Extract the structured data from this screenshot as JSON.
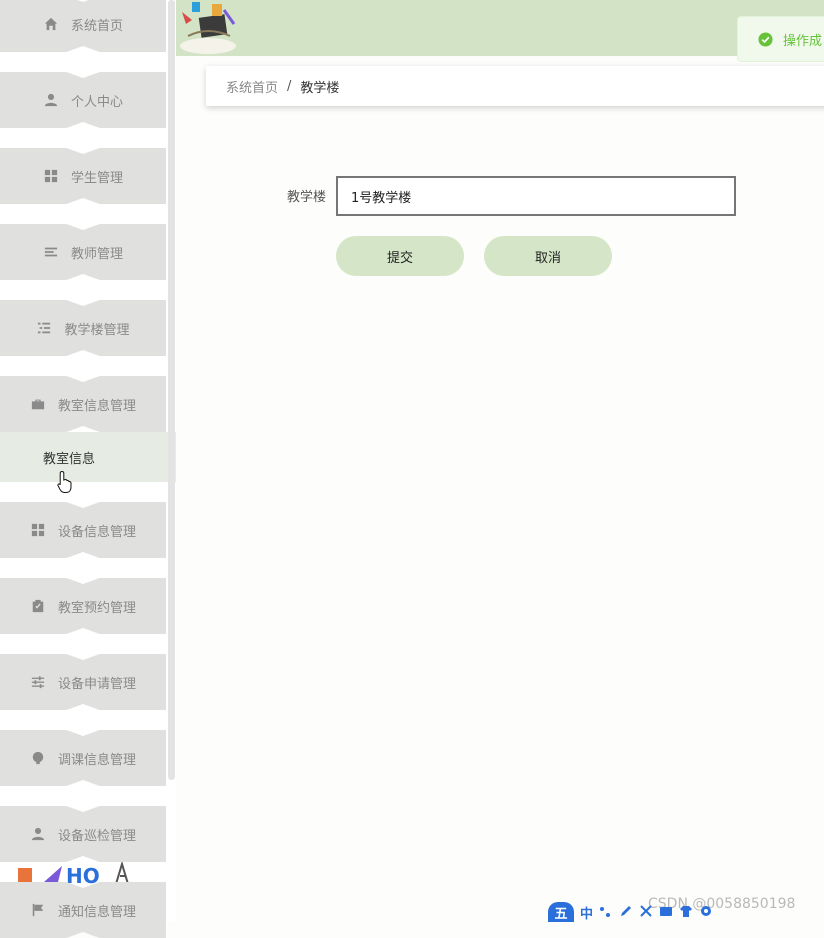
{
  "sidebar": {
    "items": [
      {
        "label": "系统首页",
        "icon": "home-icon"
      },
      {
        "label": "个人中心",
        "icon": "user-icon"
      },
      {
        "label": "学生管理",
        "icon": "grid-icon"
      },
      {
        "label": "教师管理",
        "icon": "list-icon"
      },
      {
        "label": "教学楼管理",
        "icon": "indent-list-icon"
      },
      {
        "label": "教室信息管理",
        "icon": "briefcase-icon"
      },
      {
        "label": "设备信息管理",
        "icon": "grid-icon"
      },
      {
        "label": "教室预约管理",
        "icon": "clipboard-check-icon"
      },
      {
        "label": "设备申请管理",
        "icon": "sliders-icon"
      },
      {
        "label": "调课信息管理",
        "icon": "bulb-icon"
      },
      {
        "label": "设备巡检管理",
        "icon": "user-icon"
      },
      {
        "label": "通知信息管理",
        "icon": "flag-icon"
      }
    ],
    "submenu_label": "教室信息"
  },
  "toast": {
    "text": "操作成",
    "icon": "check-circle-icon",
    "color": "#67c23a"
  },
  "breadcrumb": {
    "home": "系统首页",
    "separator": "/",
    "current": "教学楼"
  },
  "form": {
    "label": "教学楼",
    "value": "1号教学楼",
    "submit_label": "提交",
    "cancel_label": "取消"
  },
  "watermark": "CSDN @0058850198",
  "ime": {
    "logo": "五",
    "lang": "中"
  },
  "colors": {
    "accent": "#d2e4c5",
    "menu_bg": "#e0e0de",
    "submenu_bg": "#e6ece3"
  }
}
